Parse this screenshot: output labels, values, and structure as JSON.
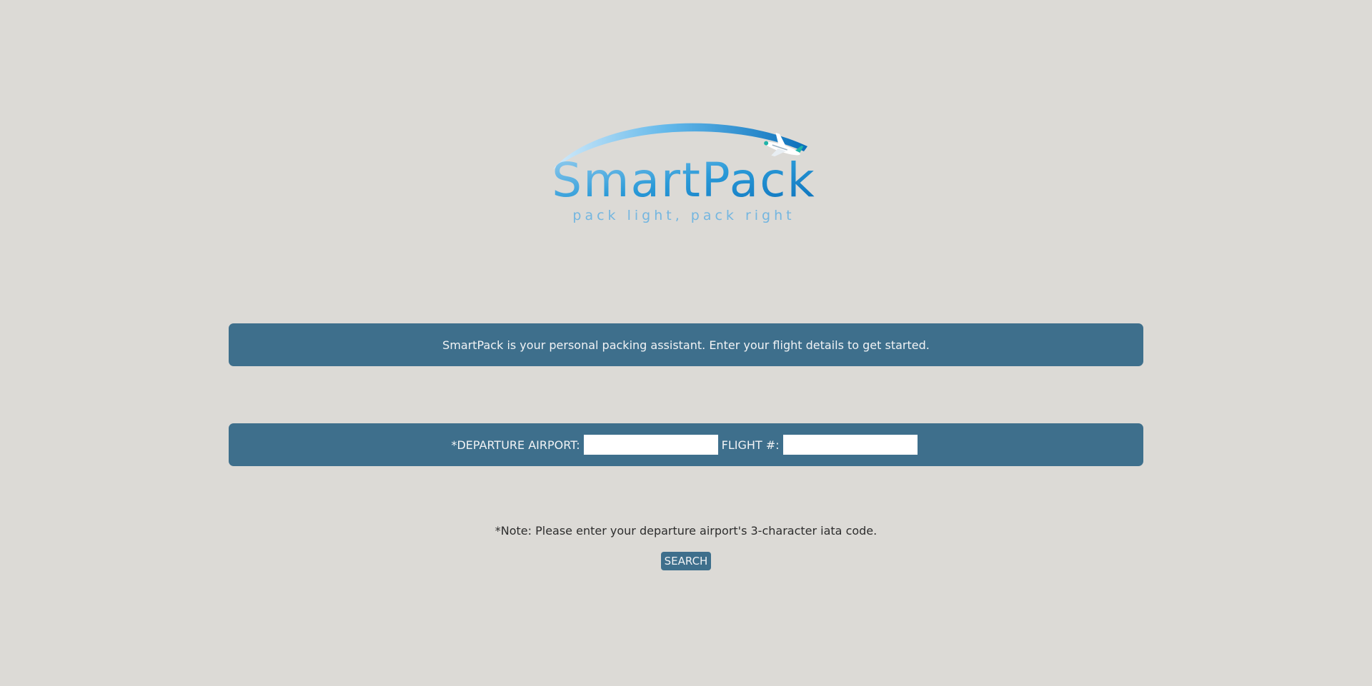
{
  "logo": {
    "brand": "SmartPack",
    "tagline": "pack light, pack right",
    "colors": {
      "light_blue": "#9cd0f0",
      "mid_blue": "#2a9ad8",
      "dark_blue": "#0a6fba",
      "teal": "#1fb3a8"
    }
  },
  "intro": {
    "text": "SmartPack is your personal packing assistant. Enter your flight details to get started."
  },
  "form": {
    "departure_label": "*DEPARTURE AIRPORT:",
    "departure_value": "",
    "flight_label": "FLIGHT #:",
    "flight_value": ""
  },
  "note": {
    "text": "*Note: Please enter your departure airport's 3-character iata code."
  },
  "search_button": {
    "label": "SEARCH"
  },
  "colors": {
    "background": "#dcdad6",
    "banner": "#3e6f8c",
    "banner_text": "#f1f3f5"
  }
}
